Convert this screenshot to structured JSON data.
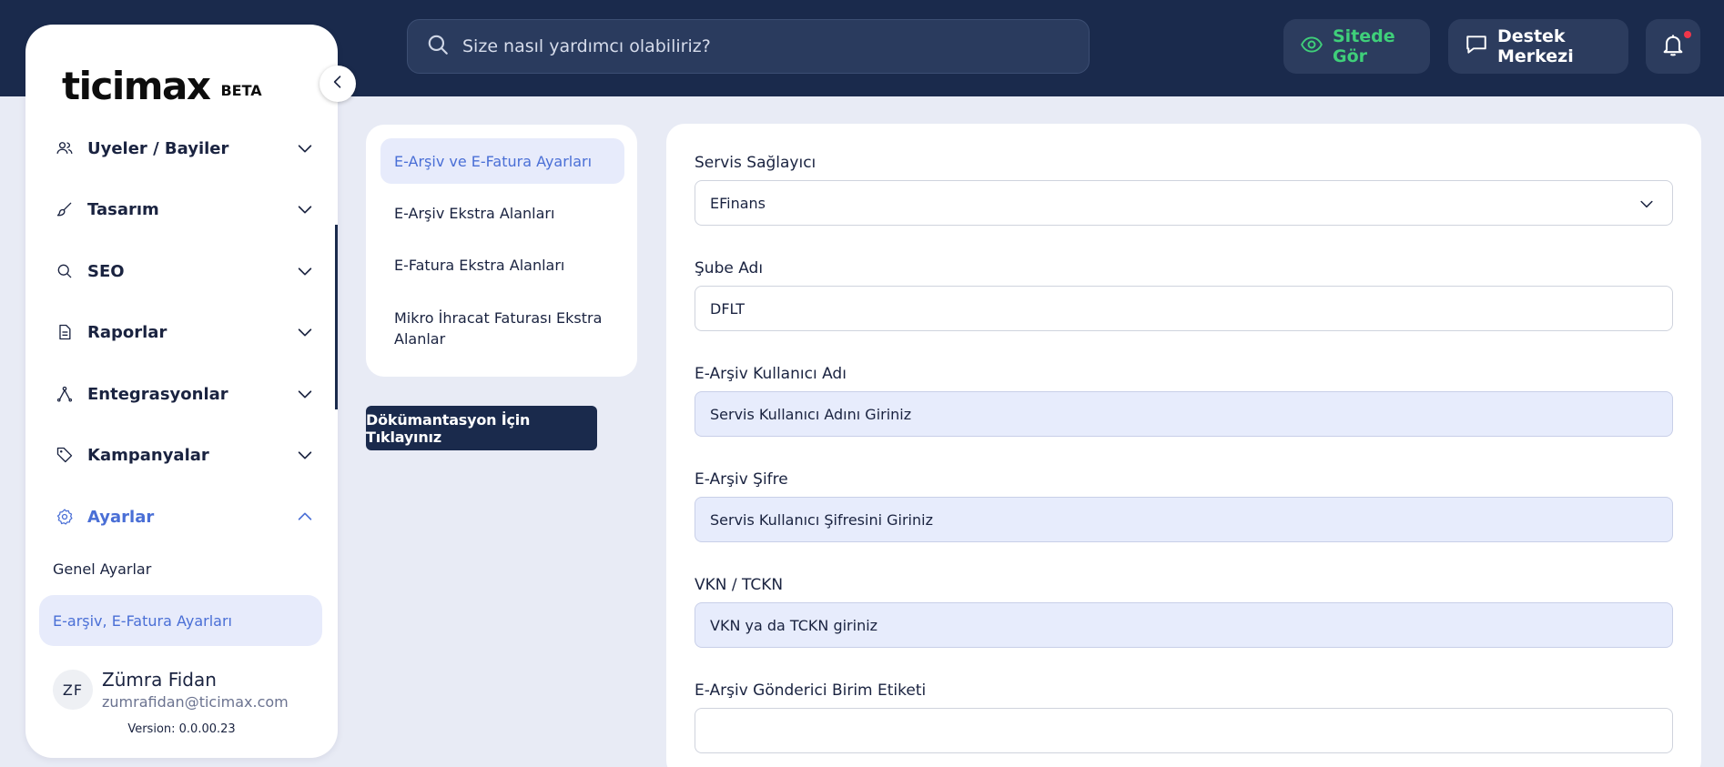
{
  "header": {
    "search_placeholder": "Size nasıl yardımcı olabiliriz?",
    "view_site_label": "Sitede Gör",
    "support_label": "Destek Merkezi"
  },
  "sidebar": {
    "logo_text": "ticimax",
    "beta_label": "BETA",
    "items": [
      {
        "label": "Uyeler / Bayiler",
        "icon": "users-icon"
      },
      {
        "label": "Tasarım",
        "icon": "brush-icon"
      },
      {
        "label": "SEO",
        "icon": "search-icon"
      },
      {
        "label": "Raporlar",
        "icon": "document-icon"
      },
      {
        "label": "Entegrasyonlar",
        "icon": "integration-icon"
      },
      {
        "label": "Kampanyalar",
        "icon": "tag-icon"
      },
      {
        "label": "Ayarlar",
        "icon": "gear-icon"
      }
    ],
    "sub_items": [
      "Genel Ayarlar",
      "E-arşiv, E-Fatura Ayarları"
    ],
    "user": {
      "initials": "ZF",
      "name": "Zümra Fidan",
      "email": "zumrafidan@ticimax.com",
      "version": "Version: 0.0.00.23"
    }
  },
  "submenu": {
    "items": [
      "E-Arşiv ve E-Fatura Ayarları",
      "E-Arşiv Ekstra Alanları",
      "E-Fatura Ekstra Alanları",
      "Mikro İhracat Faturası Ekstra Alanlar"
    ],
    "doc_button": "Dökümantasyon İçin Tıklayınız"
  },
  "form": {
    "fields": [
      {
        "label": "Servis Sağlayıcı",
        "value": "EFinans"
      },
      {
        "label": "Şube Adı",
        "value": "DFLT"
      },
      {
        "label": "E-Arşiv Kullanıcı Adı",
        "value": "Servis Kullanıcı Adını Giriniz"
      },
      {
        "label": "E-Arşiv Şifre",
        "value": "Servis Kullanıcı Şifresini Giriniz"
      },
      {
        "label": "VKN / TCKN",
        "value": "VKN ya da TCKN giriniz"
      },
      {
        "label": "E-Arşiv Gönderici Birim Etiketi",
        "value": ""
      }
    ]
  },
  "colors": {
    "topbar": "#1a2a4c",
    "accent": "#4a6fd6",
    "green": "#3fcf7a"
  }
}
